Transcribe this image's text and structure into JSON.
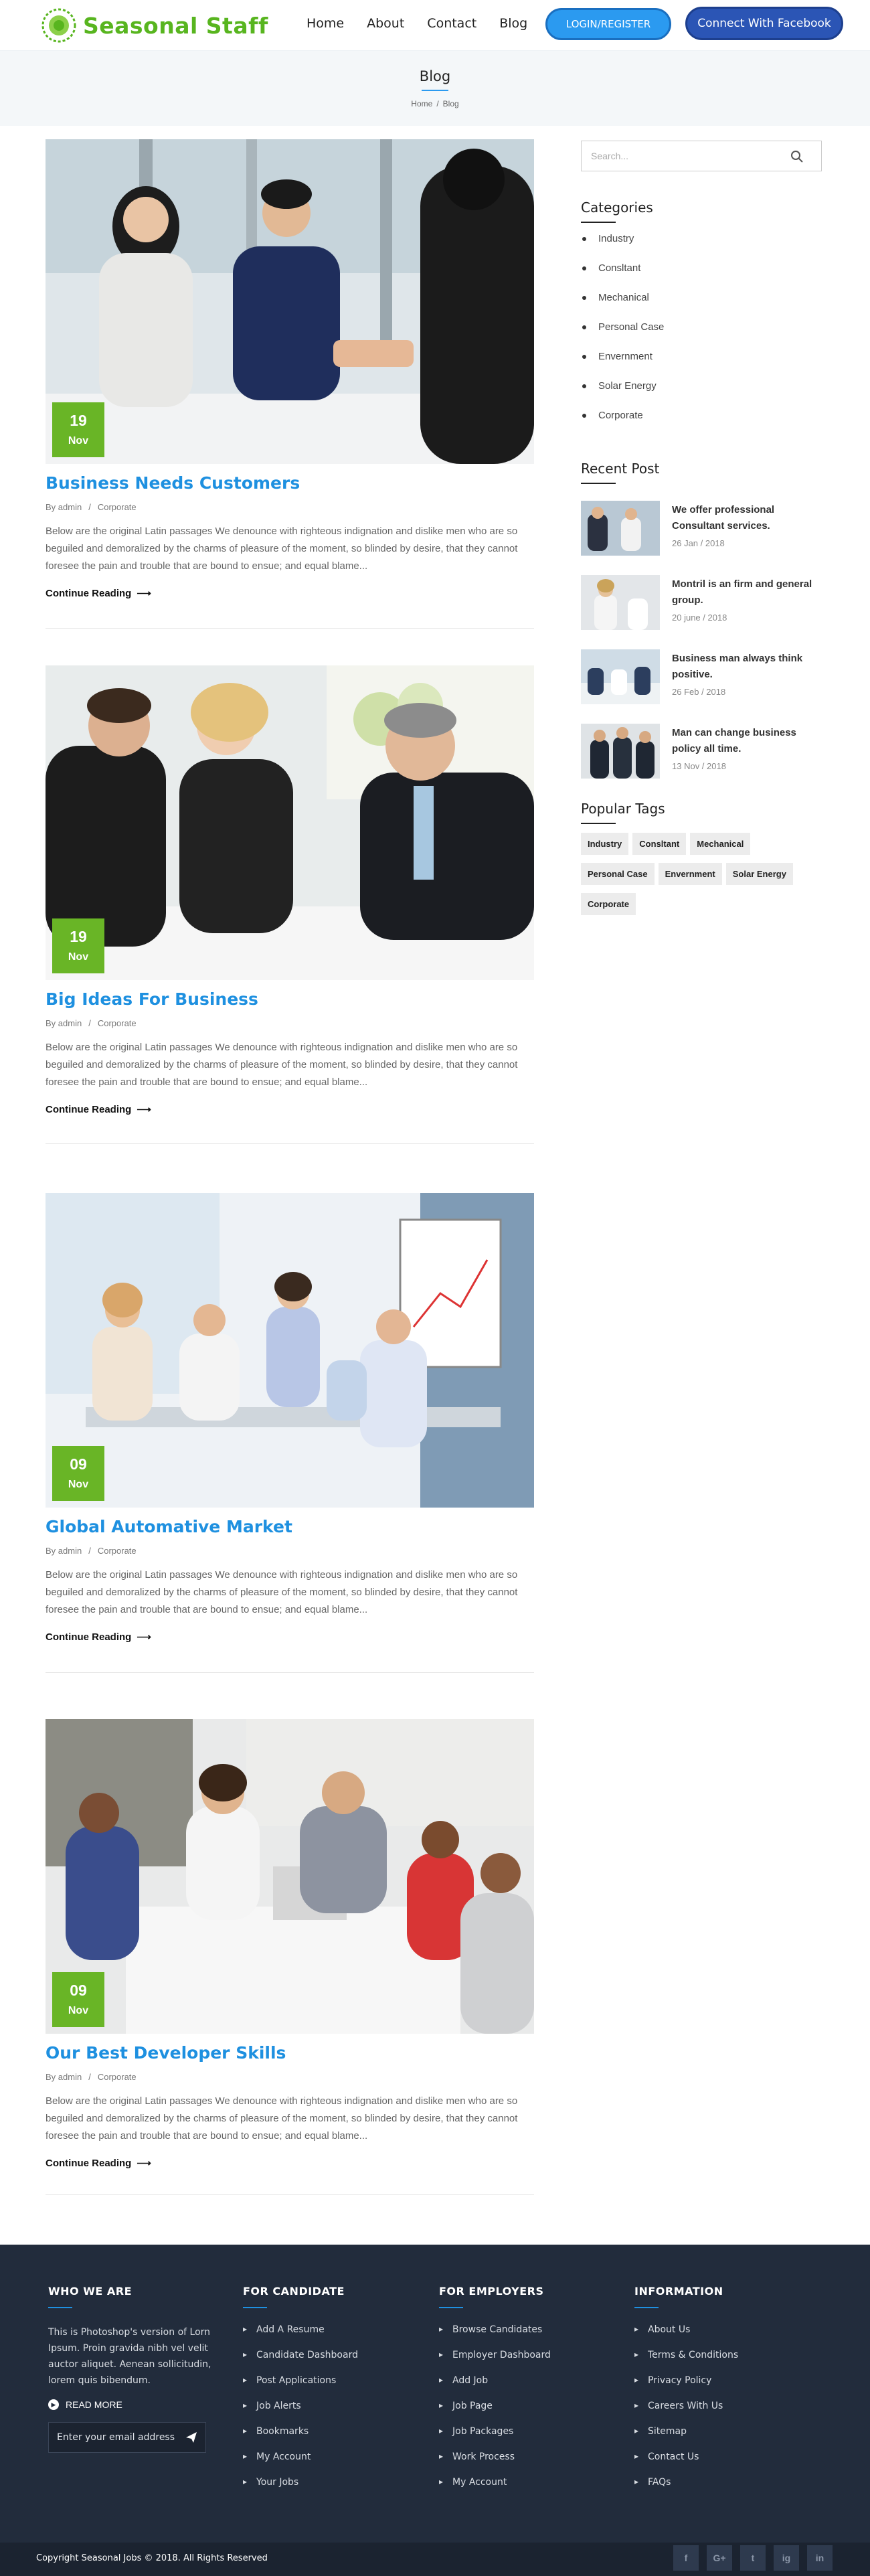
{
  "brand": {
    "name": "Seasonal Staff",
    "accent": "#58b51f",
    "link_color": "#1e90e0"
  },
  "nav": {
    "items": [
      "Home",
      "About",
      "Contact",
      "Blog"
    ],
    "login_label": "LOGIN/REGISTER",
    "facebook_label": "Connect With Facebook"
  },
  "banner": {
    "title": "Blog",
    "crumbs": [
      "Home",
      "Blog"
    ],
    "separator": "/"
  },
  "posts": [
    {
      "day": "19",
      "month": "Nov",
      "title": "Business Needs Customers",
      "author": "By admin",
      "category": "Corporate",
      "excerpt": "Below are the original Latin passages We denounce with righteous indignation and dislike men who are so beguiled and demoralized by the charms of pleasure of the moment, so blinded by desire, that they cannot foresee the pain and trouble that are bound to ensue; and equal blame...",
      "more": "Continue Reading"
    },
    {
      "day": "19",
      "month": "Nov",
      "title": "Big Ideas For Business",
      "author": "By admin",
      "category": "Corporate",
      "excerpt": "Below are the original Latin passages We denounce with righteous indignation and dislike men who are so beguiled and demoralized by the charms of pleasure of the moment, so blinded by desire, that they cannot foresee the pain and trouble that are bound to ensue; and equal blame...",
      "more": "Continue Reading"
    },
    {
      "day": "09",
      "month": "Nov",
      "title": "Global Automative Market",
      "author": "By admin",
      "category": "Corporate",
      "excerpt": "Below are the original Latin passages We denounce with righteous indignation and dislike men who are so beguiled and demoralized by the charms of pleasure of the moment, so blinded by desire, that they cannot foresee the pain and trouble that are bound to ensue; and equal blame...",
      "more": "Continue Reading"
    },
    {
      "day": "09",
      "month": "Nov",
      "title": "Our Best Developer Skills",
      "author": "By admin",
      "category": "Corporate",
      "excerpt": "Below are the original Latin passages We denounce with righteous indignation and dislike men who are so beguiled and demoralized by the charms of pleasure of the moment, so blinded by desire, that they cannot foresee the pain and trouble that are bound to ensue; and equal blame...",
      "more": "Continue Reading"
    }
  ],
  "sidebar": {
    "search_placeholder": "Search...",
    "categories_title": "Categories",
    "categories": [
      "Industry",
      "Consltant",
      "Mechanical",
      "Personal Case",
      "Envernment",
      "Solar Energy",
      "Corporate"
    ],
    "recent_title": "Recent Post",
    "recent": [
      {
        "title": "We offer professional Consultant services.",
        "date": "26 Jan / 2018"
      },
      {
        "title": "Montril is an firm and general group.",
        "date": "20 june / 2018"
      },
      {
        "title": "Business man always think positive.",
        "date": "26 Feb / 2018"
      },
      {
        "title": "Man can change business policy all time.",
        "date": "13 Nov / 2018"
      }
    ],
    "tags_title": "Popular Tags",
    "tags": [
      "Industry",
      "Consltant",
      "Mechanical",
      "Personal Case",
      "Envernment",
      "Solar Energy",
      "Corporate"
    ]
  },
  "footer": {
    "who": {
      "title": "WHO WE ARE",
      "text": "This is Photoshop's version of Lorn Ipsum. Proin gravida nibh vel velit auctor aliquet. Aenean sollicitudin, lorem quis bibendum.",
      "read_more": "READ MORE",
      "email_placeholder": "Enter your email address"
    },
    "candidate": {
      "title": "FOR CANDIDATE",
      "links": [
        "Add A Resume",
        "Candidate Dashboard",
        "Post Applications",
        "Job Alerts",
        "Bookmarks",
        "My Account",
        "Your Jobs"
      ]
    },
    "employers": {
      "title": "FOR EMPLOYERS",
      "links": [
        "Browse Candidates",
        "Employer Dashboard",
        "Add Job",
        "Job Page",
        "Job Packages",
        "Work Process",
        "My Account"
      ]
    },
    "information": {
      "title": "INFORMATION",
      "links": [
        "About Us",
        "Terms & Conditions",
        "Privacy Policy",
        "Careers With Us",
        "Sitemap",
        "Contact Us",
        "FAQs"
      ]
    },
    "copyright": "Copyright Seasonal Jobs © 2018. All Rights Reserved",
    "social": [
      "f",
      "G+",
      "t",
      "ig",
      "in"
    ]
  }
}
